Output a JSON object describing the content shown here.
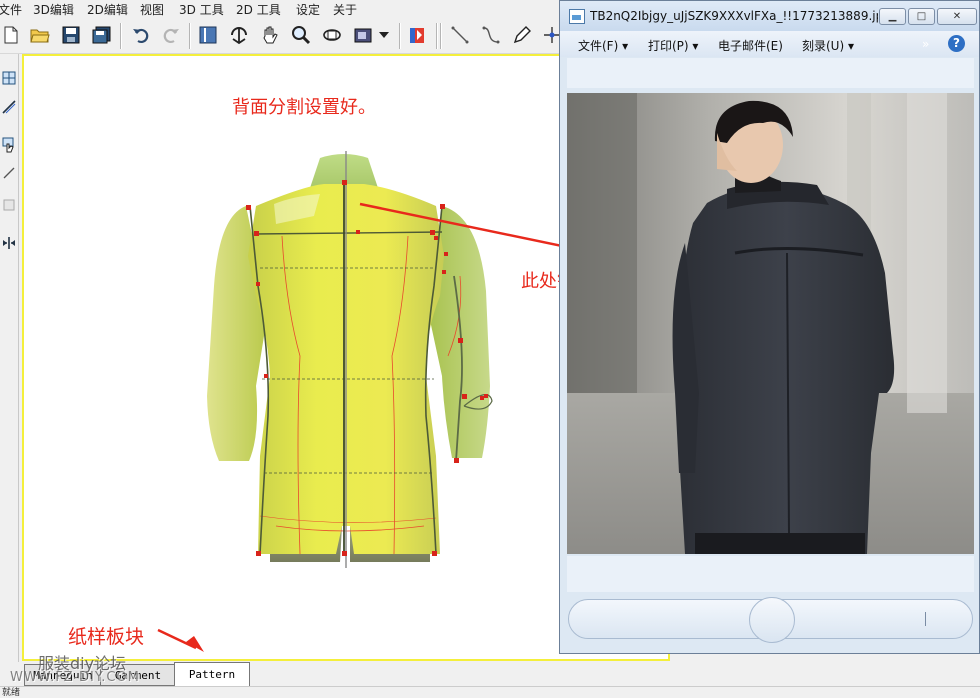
{
  "menubar": {
    "items": [
      "文件",
      "3D编辑",
      "2D编辑",
      "视图",
      "3D 工具",
      "2D 工具",
      "设定",
      "关于"
    ]
  },
  "toolbar": {
    "icons": [
      "new-file-icon",
      "open-folder-icon",
      "save-icon",
      "save-all-icon",
      "undo-icon",
      "redo-icon",
      "panel-icon",
      "rotate-icon",
      "hand-icon",
      "zoom-icon",
      "orbit-icon",
      "render-icon",
      "dropdown-arrow-icon",
      "flag-icon",
      "line-tool-icon",
      "curve-tool-icon",
      "pen-icon",
      "point-tool-icon"
    ]
  },
  "leftbar": {
    "icons": [
      "mesh-icon",
      "cut-line-icon",
      "hand-select-icon",
      "line-icon",
      "shape-icon",
      "split-icon"
    ]
  },
  "viewport": {
    "annotation_top": "背面分割设置好。",
    "annotation_error": "此处错误！",
    "annotation_panel": "纸样板块",
    "accent_color": "#e8291c",
    "border_color": "#f4ef3b"
  },
  "tabs": {
    "items": [
      "Mannequin",
      "Garment",
      "Pattern"
    ],
    "active": "Pattern"
  },
  "watermark": {
    "line1": "服装diy论坛",
    "line2": "WWW.FZ-DIY.COM"
  },
  "statusbar": {
    "text": "就绪"
  },
  "viewer": {
    "title": "TB2nQ2Ibjgy_uJjSZK9XXXvlFXa_!!1773213889.jp...",
    "menu": {
      "file": "文件(F)",
      "print": "打印(P)",
      "email": "电子邮件(E)",
      "burn": "刻录(U)",
      "more": "»"
    },
    "buttons": {
      "minimize": "▁",
      "maximize": "□",
      "close": "✕"
    },
    "help": "?"
  }
}
